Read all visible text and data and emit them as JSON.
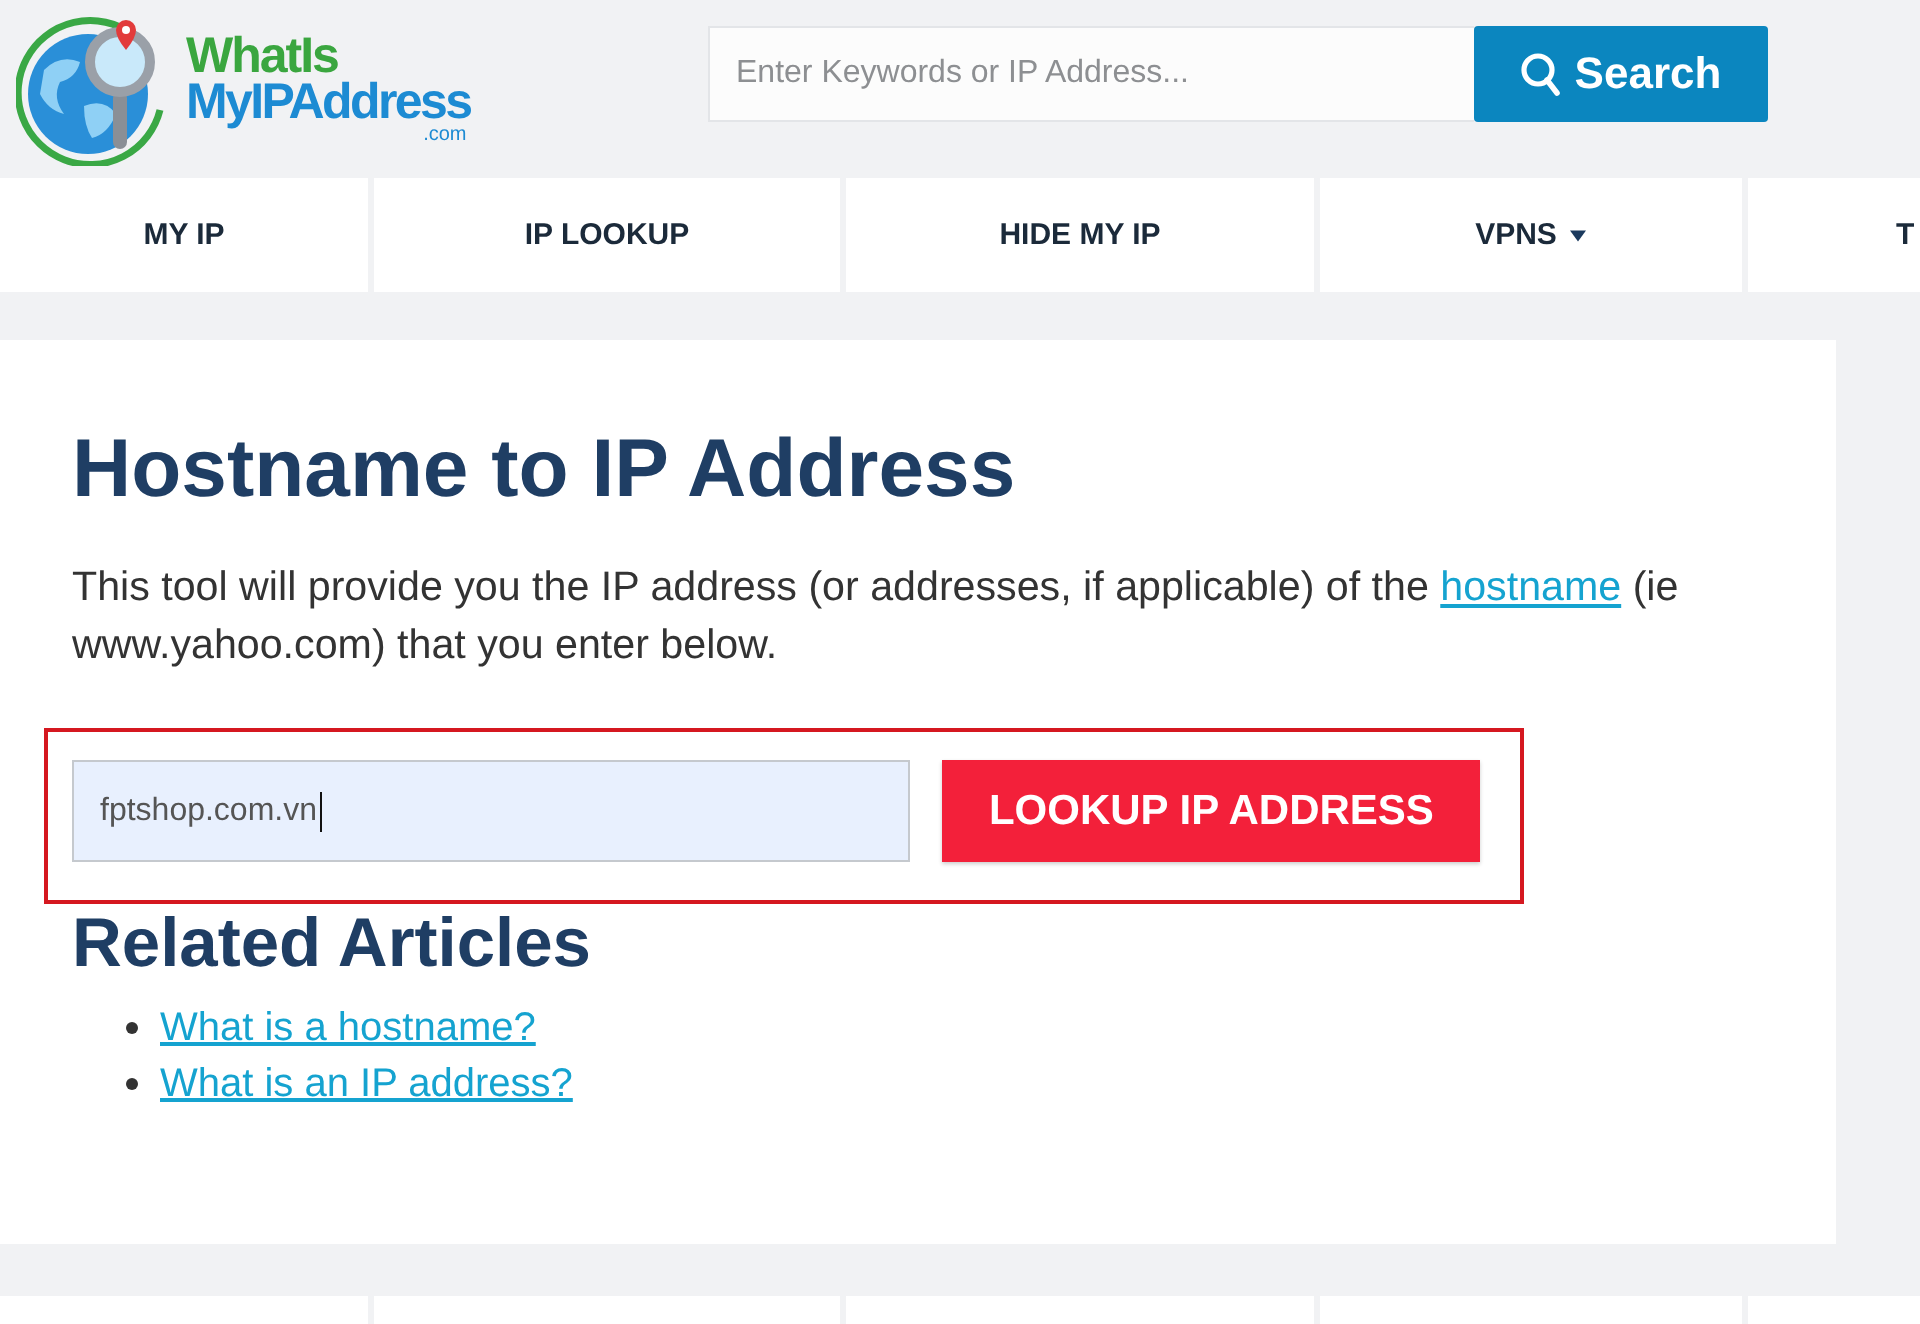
{
  "header": {
    "logo": {
      "line1": "WhatIs",
      "line2": "MyIPAddress",
      "suffix": ".com"
    },
    "search": {
      "placeholder": "Enter Keywords or IP Address...",
      "button": "Search"
    }
  },
  "nav": [
    {
      "label": "MY IP",
      "kind": "link"
    },
    {
      "label": "IP LOOKUP",
      "kind": "link"
    },
    {
      "label": "HIDE MY IP",
      "kind": "link"
    },
    {
      "label": "VPNS",
      "kind": "dropdown"
    },
    {
      "label": "T",
      "kind": "link"
    }
  ],
  "content": {
    "title": "Hostname to IP Address",
    "intro_before": "This tool will provide you the IP address (or addresses, if applicable) of the",
    "intro_link": "hostname",
    "intro_after": "(ie www.yahoo.com) that you enter below.",
    "lookup": {
      "highlighted": true,
      "value": "fptshop.com.vn",
      "focused": true,
      "button": "LOOKUP IP ADDRESS"
    },
    "related": {
      "title": "Related Articles",
      "links": [
        "What is a hostname?",
        "What is an IP address?"
      ]
    }
  }
}
